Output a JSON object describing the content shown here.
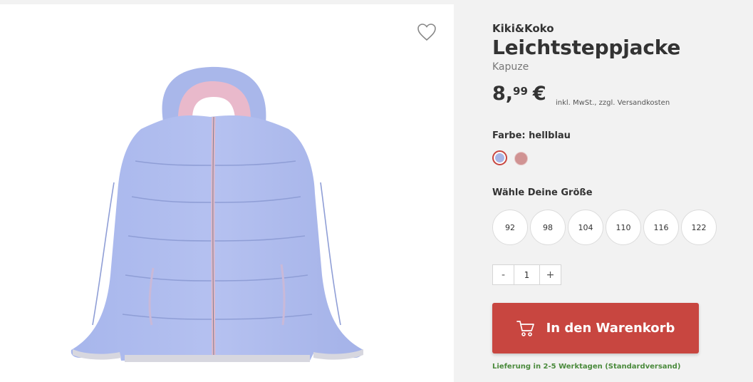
{
  "product": {
    "brand": "Kiki&Koko",
    "title": "Leichtsteppjacke",
    "subtitle": "Kapuze",
    "price_whole": "8,",
    "price_cents": "99",
    "currency": "€",
    "vat_note": "inkl. MwSt., zzgl. Versandkosten"
  },
  "colors": {
    "label": "Farbe: hellblau",
    "options": [
      {
        "name": "hellblau",
        "hex": "#a8b5e6",
        "selected": true
      },
      {
        "name": "rose",
        "hex": "#d09393",
        "selected": false
      }
    ]
  },
  "sizes": {
    "label": "Wähle Deine Größe",
    "options": [
      "92",
      "98",
      "104",
      "110",
      "116",
      "122"
    ]
  },
  "quantity": {
    "minus": "-",
    "value": "1",
    "plus": "+"
  },
  "cart": {
    "label": "In den Warenkorb"
  },
  "delivery": {
    "text": "Lieferung in 2-5 Werktagen (Standardversand)"
  },
  "colors_theme": {
    "accent": "#c84640",
    "delivery": "#4a8a3c"
  },
  "icons": [
    "heart-icon",
    "cart-icon"
  ]
}
